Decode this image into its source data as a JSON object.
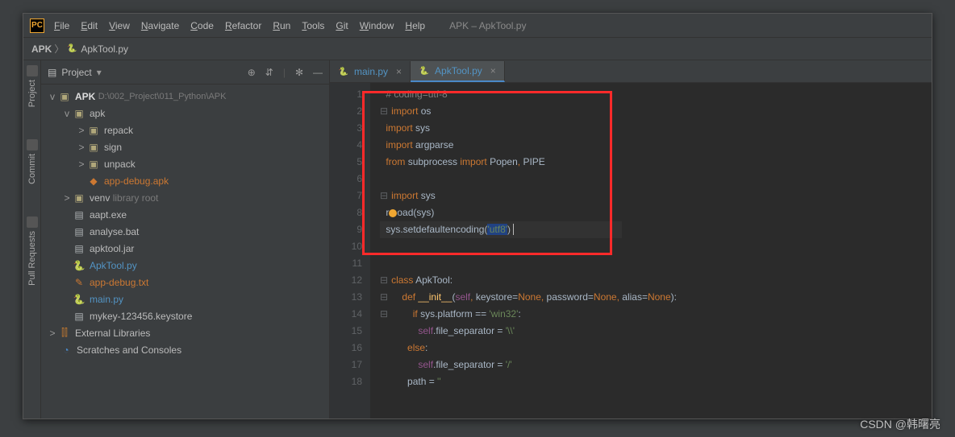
{
  "window": {
    "title": "APK – ApkTool.py"
  },
  "menu": [
    "File",
    "Edit",
    "View",
    "Navigate",
    "Code",
    "Refactor",
    "Run",
    "Tools",
    "Git",
    "Window",
    "Help"
  ],
  "breadcrumb": {
    "root": "APK",
    "file": "ApkTool.py"
  },
  "sidebar": {
    "title": "Project",
    "project": {
      "name": "APK",
      "path": "D:\\002_Project\\011_Python\\APK"
    },
    "tree": [
      {
        "indent": 1,
        "chev": "v",
        "type": "folder",
        "label": "apk"
      },
      {
        "indent": 2,
        "chev": ">",
        "type": "folder",
        "label": "repack"
      },
      {
        "indent": 2,
        "chev": ">",
        "type": "folder",
        "label": "sign"
      },
      {
        "indent": 2,
        "chev": ">",
        "type": "folder",
        "label": "unpack"
      },
      {
        "indent": 2,
        "chev": "",
        "type": "apk",
        "label": "app-debug.apk"
      },
      {
        "indent": 1,
        "chev": ">",
        "type": "folder",
        "label": "venv",
        "suffix": "library root",
        "muted": true
      },
      {
        "indent": 1,
        "chev": "",
        "type": "file",
        "label": "aapt.exe"
      },
      {
        "indent": 1,
        "chev": "",
        "type": "file",
        "label": "analyse.bat"
      },
      {
        "indent": 1,
        "chev": "",
        "type": "file",
        "label": "apktool.jar"
      },
      {
        "indent": 1,
        "chev": "",
        "type": "pyf",
        "label": "ApkTool.py"
      },
      {
        "indent": 1,
        "chev": "",
        "type": "txt",
        "label": "app-debug.txt"
      },
      {
        "indent": 1,
        "chev": "",
        "type": "pyf",
        "label": "main.py"
      },
      {
        "indent": 1,
        "chev": "",
        "type": "file",
        "label": "mykey-123456.keystore"
      }
    ],
    "extlib": "External Libraries",
    "scratches": "Scratches and Consoles"
  },
  "tabs": [
    {
      "label": "main.py",
      "active": false
    },
    {
      "label": "ApkTool.py",
      "active": true
    }
  ],
  "code": {
    "lines": [
      {
        "n": 1,
        "segs": [
          {
            "t": "# coding=utf-8",
            "c": "cmt"
          }
        ]
      },
      {
        "n": 2,
        "fold": true,
        "segs": [
          {
            "t": "import ",
            "c": "kw"
          },
          {
            "t": "os"
          }
        ]
      },
      {
        "n": 3,
        "segs": [
          {
            "t": "import ",
            "c": "kw"
          },
          {
            "t": "sys"
          }
        ]
      },
      {
        "n": 4,
        "segs": [
          {
            "t": "import ",
            "c": "kw"
          },
          {
            "t": "argparse"
          }
        ]
      },
      {
        "n": 5,
        "segs": [
          {
            "t": "from ",
            "c": "kw"
          },
          {
            "t": "subprocess "
          },
          {
            "t": "import ",
            "c": "kw"
          },
          {
            "t": "Popen"
          },
          {
            "t": ", ",
            "c": "kw"
          },
          {
            "t": "PIPE"
          }
        ]
      },
      {
        "n": 6,
        "segs": []
      },
      {
        "n": 7,
        "fold": true,
        "segs": [
          {
            "t": "import ",
            "c": "kw"
          },
          {
            "t": "sys"
          }
        ]
      },
      {
        "n": 8,
        "bulb": true,
        "segs": [
          {
            "t": "r"
          },
          {
            "t": "l"
          },
          {
            "t": "oad",
            "c": ""
          },
          {
            "t": "(sys)"
          }
        ]
      },
      {
        "n": 9,
        "hl": true,
        "segs": [
          {
            "t": "sys.setdefaultencoding"
          },
          {
            "t": "(",
            "c": ""
          },
          {
            "t": "'utf8'",
            "c": "str",
            "bg": true
          },
          {
            "t": ")",
            "c": ""
          }
        ]
      },
      {
        "n": 10,
        "segs": []
      },
      {
        "n": 11,
        "segs": []
      },
      {
        "n": 12,
        "fold": true,
        "segs": [
          {
            "t": "class ",
            "c": "kw"
          },
          {
            "t": "ApkTool:"
          }
        ]
      },
      {
        "n": 13,
        "indent": 1,
        "fold": true,
        "segs": [
          {
            "t": "def ",
            "c": "kw"
          },
          {
            "t": "__init__",
            "c": "fn"
          },
          {
            "t": "("
          },
          {
            "t": "self",
            "c": "self"
          },
          {
            "t": ", ",
            "c": "kw"
          },
          {
            "t": "keystore="
          },
          {
            "t": "None",
            "c": "kw"
          },
          {
            "t": ", ",
            "c": "kw"
          },
          {
            "t": "password="
          },
          {
            "t": "None",
            "c": "kw"
          },
          {
            "t": ", ",
            "c": "kw"
          },
          {
            "t": "alias="
          },
          {
            "t": "None",
            "c": "kw"
          },
          {
            "t": "):"
          }
        ]
      },
      {
        "n": 14,
        "indent": 2,
        "fold": true,
        "segs": [
          {
            "t": "if ",
            "c": "kw"
          },
          {
            "t": "sys.platform == "
          },
          {
            "t": "'win32'",
            "c": "str"
          },
          {
            "t": ":"
          }
        ]
      },
      {
        "n": 15,
        "indent": 3,
        "segs": [
          {
            "t": "self",
            "c": "self"
          },
          {
            "t": ".file_separator = "
          },
          {
            "t": "'\\\\'",
            "c": "str"
          }
        ]
      },
      {
        "n": 16,
        "indent": 2,
        "segs": [
          {
            "t": "else",
            "c": "kw"
          },
          {
            "t": ":"
          }
        ]
      },
      {
        "n": 17,
        "indent": 3,
        "segs": [
          {
            "t": "self",
            "c": "self"
          },
          {
            "t": ".file_separator = "
          },
          {
            "t": "'/'",
            "c": "str"
          }
        ]
      },
      {
        "n": 18,
        "indent": 2,
        "segs": [
          {
            "t": "path = "
          },
          {
            "t": "''",
            "c": "str"
          }
        ]
      }
    ]
  },
  "leftrail": [
    "Project",
    "Commit",
    "Pull Requests"
  ],
  "watermark": "CSDN @韩曙亮"
}
